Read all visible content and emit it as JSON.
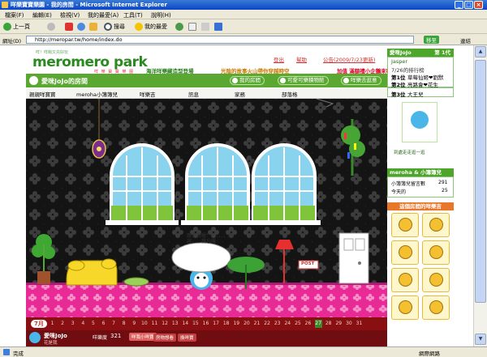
{
  "window": {
    "title": "咩樂寶寶樂園 - 我的房間 - Microsoft Internet Explorer",
    "menu": [
      "檔案(F)",
      "編輯(E)",
      "檢視(V)",
      "我的最愛(A)",
      "工具(T)",
      "說明(H)"
    ],
    "toolbar": {
      "back": "上一頁",
      "search": "搜尋",
      "favorites": "我的最愛"
    },
    "address_label": "網址(D)",
    "address_value": "http://meropar.tw/home/index.do",
    "go_label": "移至",
    "links_label": "連結",
    "status_left": "完成",
    "status_right": "網際網路"
  },
  "site": {
    "logo": "meromero park",
    "logo_tagline": "咩！咩萌又充好玩",
    "logo_sub": "咩 樂 寶 寶 樂 園",
    "header_links": {
      "logout": "登出",
      "help": "幫助",
      "notice": "公告(2009/7/23更新)"
    },
    "promos": [
      "海洋咩樂藏造型登場",
      "光陰的故事火山帶你穿越時空",
      "加值 滿額禮小企鵝來囉"
    ]
  },
  "room_bar": {
    "title": "愛咪JoJo的房間",
    "buttons": [
      "我的房間",
      "可愛可樂積物館",
      "咩樂去逛意"
    ]
  },
  "tabs": [
    "親親咩寶寶",
    "meroha小簿簿兒",
    "咩樂吉",
    "訊息",
    "家務",
    "部落格"
  ],
  "room": {
    "counter": "991",
    "counter_label": "造訪",
    "speech": "跟你說喔！！．．．．內容，…我忘嘍",
    "sign": "POST"
  },
  "calendar": {
    "month": "7月",
    "days": [
      "1",
      "2",
      "3",
      "4",
      "5",
      "6",
      "7",
      "8",
      "9",
      "10",
      "11",
      "12",
      "13",
      "14",
      "15",
      "16",
      "17",
      "18",
      "19",
      "20",
      "21",
      "22",
      "23",
      "24",
      "25",
      "26",
      "27",
      "28",
      "29",
      "30",
      "31"
    ]
  },
  "bottom_bar": {
    "name": "愛咪JoJo",
    "sub": "花是我",
    "stat_label": "咩樂度",
    "stat_value": "321",
    "buttons": [
      "咩我小咩寶",
      "房物想看",
      "換咩寶"
    ]
  },
  "sidebar": {
    "profile_name": "愛咪JoJo",
    "profile_rank": "第 1代",
    "best_friend": "Jasper",
    "ranking_title": "7/26的排行榜",
    "ranking": [
      {
        "pos": "第1位",
        "name": "草莓仙姬❤劉默"
      },
      {
        "pos": "第2位",
        "name": "亮路會❤花生"
      },
      {
        "pos": "第3位",
        "name": "大王兒"
      }
    ],
    "visit_link": "到處走走逛一逛",
    "meroha_title": "meroha & 小簿簿兒",
    "stats": [
      {
        "label": "小簿簿兒留言數",
        "value": "291"
      },
      {
        "label": "今天的",
        "value": "25"
      }
    ],
    "gallery_title": "這個房間的咩樂吉"
  },
  "colors": {
    "room_bg": "#141414",
    "floor": "#e82a97",
    "room_bar": "#5aa832",
    "calendar": "#8a0f12"
  }
}
